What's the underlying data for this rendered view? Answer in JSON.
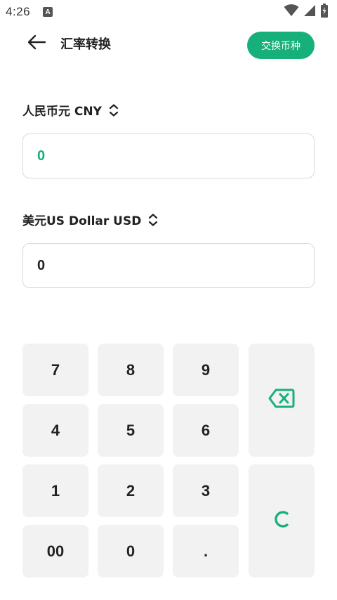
{
  "status_bar": {
    "time": "4:26",
    "notification_icon_letter": "A",
    "icons": [
      "wifi-icon",
      "signal-icon",
      "battery-icon"
    ]
  },
  "header": {
    "title": "汇率转换",
    "swap_button_label": "交换币种"
  },
  "from_currency": {
    "label": "人民币元 CNY",
    "value": "0"
  },
  "to_currency": {
    "label": "美元US Dollar USD",
    "value": "0"
  },
  "keypad": {
    "keys": [
      "7",
      "8",
      "9",
      "4",
      "5",
      "6",
      "1",
      "2",
      "3",
      "00",
      "0",
      "."
    ],
    "backspace_icon": "backspace-icon",
    "clear_icon": "clear-icon"
  },
  "colors": {
    "accent": "#18b07a",
    "key_bg": "#f2f2f2",
    "border": "#d9d9d9"
  }
}
